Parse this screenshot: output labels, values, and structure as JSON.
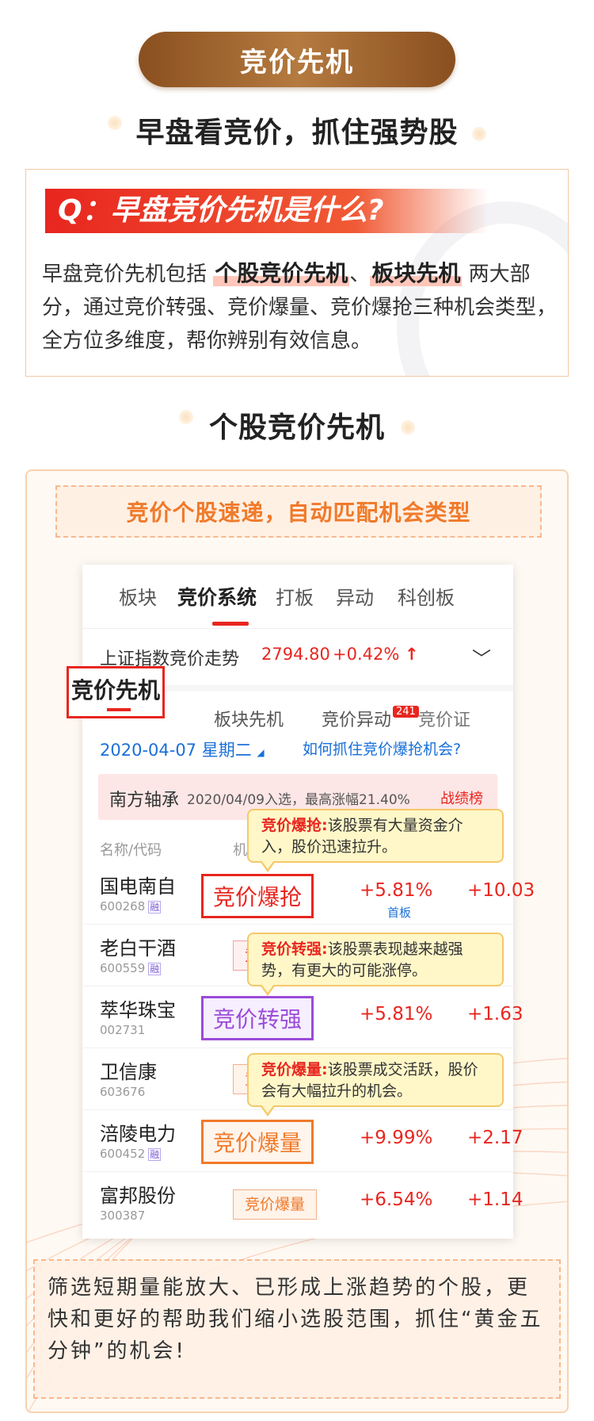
{
  "banner": {
    "title": "竞价先机"
  },
  "heading1": "早盘看竞价，抓住强势股",
  "question": {
    "title": "Q：早盘竞价先机是什么?",
    "text_a": "早盘竞价先机包括",
    "highlight1": "个股竞价先机",
    "highlight2": "板块先机",
    "text_b": "两大部分，通过竞价转强、竞价爆量、竞价爆抢三种机会类型，全方位多维度，帮你辨别有效信息。"
  },
  "heading2": "个股竞价先机",
  "card": {
    "title": "竞价个股速递，自动匹配机会类型",
    "tabs": [
      "板块",
      "竞价系统",
      "打板",
      "异动",
      "科创板"
    ],
    "index": {
      "label": "上证指数竞价走势",
      "value": "2794.80",
      "change": "+0.42%",
      "arrow": "↑",
      "chevron": "﹀"
    },
    "subtabs": {
      "active": "竞价先机",
      "t2": "板块先机",
      "t3": "竞价异动",
      "badge": "241",
      "t4": "竞价证"
    },
    "date": "2020-04-07 星期二",
    "date_caret": "◢",
    "help_link": "如何抓住竞价爆抢机会?",
    "notice": {
      "stock": "南方轴承",
      "detail": "2020/04/09入选，最高涨幅21.40%",
      "link": "战绩榜 >"
    },
    "col_name": "名称/代码",
    "col_type": "机会",
    "rong": "融",
    "rows": [
      {
        "name": "国电南自",
        "code": "600268",
        "rong": true,
        "tag": "竞价爆抢",
        "chg": "+5.81%",
        "sub": "首板",
        "chg2": "+10.03"
      },
      {
        "name": "老白干酒",
        "code": "600559",
        "rong": true,
        "tag": "竞价转强",
        "chg": "",
        "sub": "",
        "chg2": ""
      },
      {
        "name": "萃华珠宝",
        "code": "002731",
        "rong": false,
        "tag": "竞价转强",
        "chg": "+5.81%",
        "sub": "",
        "chg2": "+1.63"
      },
      {
        "name": "卫信康",
        "code": "603676",
        "rong": false,
        "tag": "竞价爆量",
        "chg": "",
        "sub": "",
        "chg2": ""
      },
      {
        "name": "涪陵电力",
        "code": "600452",
        "rong": true,
        "tag": "竞价爆量",
        "chg": "+9.99%",
        "sub": "",
        "chg2": "+2.17"
      },
      {
        "name": "富邦股份",
        "code": "300387",
        "rong": false,
        "tag": "竞价爆量",
        "chg": "+6.54%",
        "sub": "",
        "chg2": "+1.14"
      }
    ],
    "tips": [
      {
        "title": "竞价爆抢:",
        "text": "该股票有大量资金介入，股价迅速拉升。"
      },
      {
        "title": "竞价转强:",
        "text": "该股票表现越来越强势，有更大的可能涨停。"
      },
      {
        "title": "竞价爆量:",
        "text": "该股票成交活跃，股价会有大幅拉升的机会。"
      }
    ],
    "footer": "筛选短期量能放大、已形成上涨趋势的个股，更快和更好的帮助我们缩小选股范围，抓住“黄金五分钟”的机会!"
  },
  "colors": {
    "accent_red": "#e8261f",
    "brown": "#8a4f1f",
    "orange": "#f07a2a",
    "purple": "#9b4bd8",
    "link_blue": "#1a6fd8"
  }
}
